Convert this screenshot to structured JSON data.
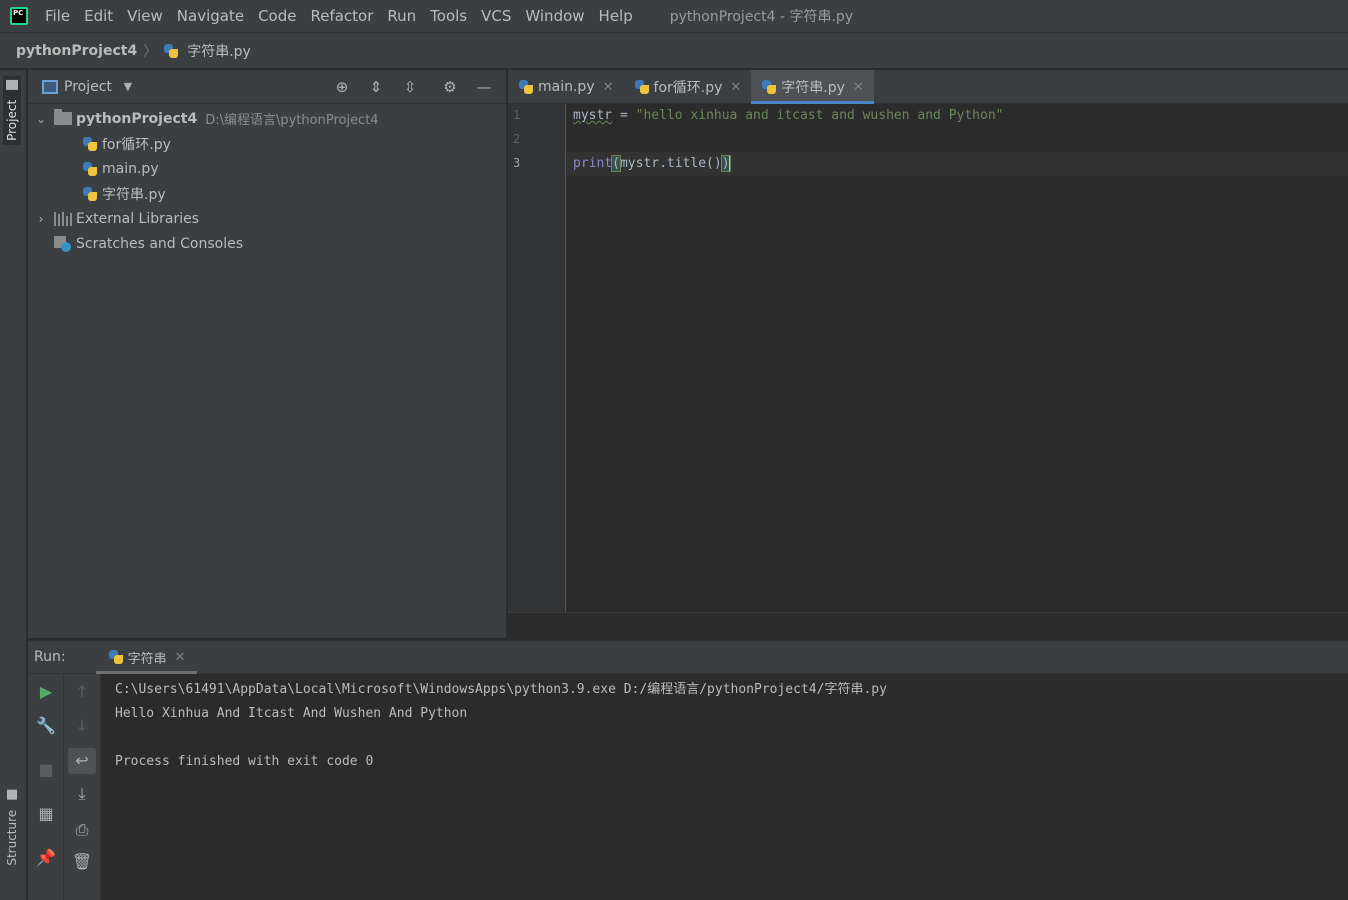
{
  "menubar": {
    "logo_text": "PC",
    "items": [
      "File",
      "Edit",
      "View",
      "Navigate",
      "Code",
      "Refactor",
      "Run",
      "Tools",
      "VCS",
      "Window",
      "Help"
    ],
    "window_title": "pythonProject4 - 字符串.py"
  },
  "navbar": {
    "project": "pythonProject4",
    "separator": "〉",
    "file": "字符串.py"
  },
  "left_strip": {
    "project_tab": "Project",
    "structure_tab": "Structure"
  },
  "project_panel": {
    "title": "Project",
    "tree": {
      "root_name": "pythonProject4",
      "root_path": "D:\\编程语言\\pythonProject4",
      "files": [
        "for循环.py",
        "main.py",
        "字符串.py"
      ],
      "external_libraries": "External Libraries",
      "scratches": "Scratches and Consoles"
    }
  },
  "editor": {
    "tabs": [
      {
        "label": "main.py",
        "active": false
      },
      {
        "label": "for循环.py",
        "active": false
      },
      {
        "label": "字符串.py",
        "active": true
      }
    ],
    "line_numbers": [
      "1",
      "2",
      "3"
    ],
    "code": {
      "l1_var": "mystr",
      "l1_op": " = ",
      "l1_str": "\"hello xinhua and itcast and wushen and Python\"",
      "l3_builtin": "print",
      "l3_open": "(",
      "l3_body": "mystr.title()",
      "l3_close": ")"
    }
  },
  "run": {
    "label": "Run:",
    "tab": "字符串",
    "console_lines": [
      "C:\\Users\\61491\\AppData\\Local\\Microsoft\\WindowsApps\\python3.9.exe D:/编程语言/pythonProject4/字符串.py",
      "Hello Xinhua And Itcast And Wushen And Python",
      "",
      "Process finished with exit code 0"
    ]
  },
  "colors": {
    "accent": "#4a88c7",
    "string": "#6a8759",
    "builtin": "#8888c6",
    "run_green": "#59a869"
  }
}
